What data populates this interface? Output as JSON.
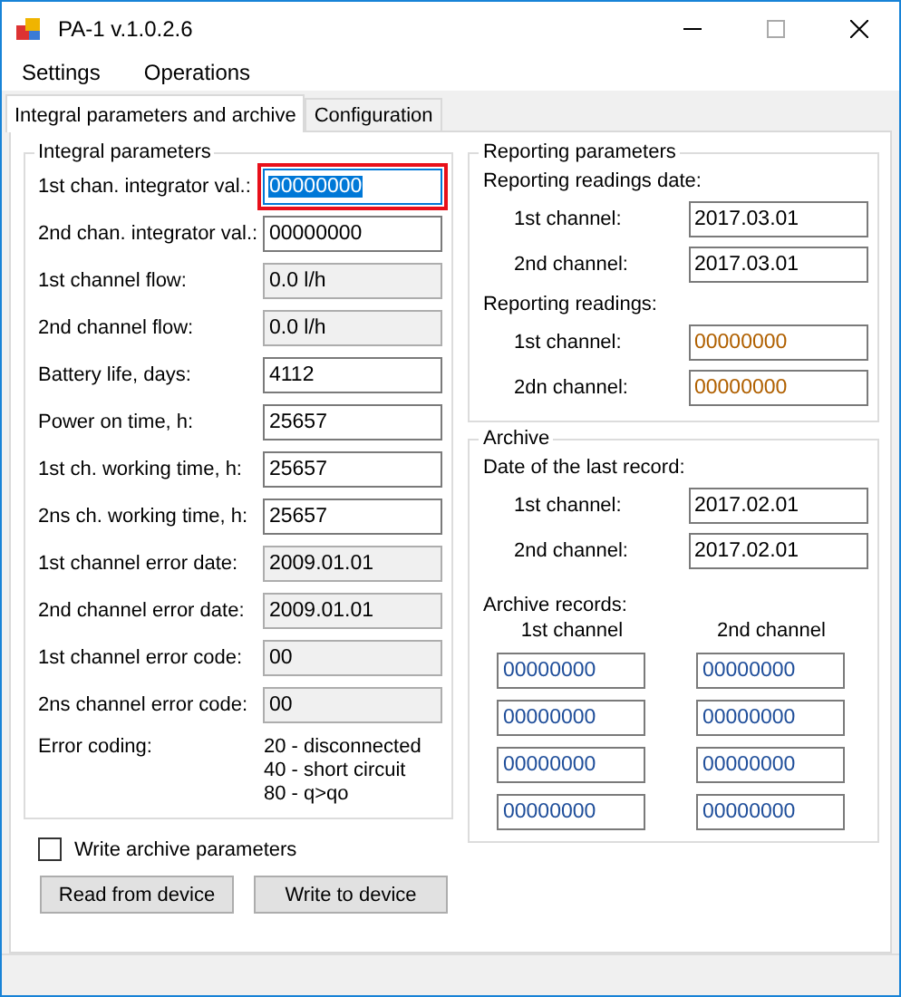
{
  "window": {
    "title": "PA-1 v.1.0.2.6"
  },
  "menu": [
    "Settings",
    "Operations"
  ],
  "tabs": [
    {
      "label": "Integral parameters and archive",
      "selected": true
    },
    {
      "label": "Configuration",
      "selected": false
    }
  ],
  "integral": {
    "title": "Integral parameters",
    "fields": [
      {
        "label": "1st chan. integrator val.:",
        "value": "00000000",
        "kind": "input",
        "focused": true
      },
      {
        "label": "2nd chan. integrator val.:",
        "value": "00000000",
        "kind": "input",
        "focused": false
      },
      {
        "label": "1st channel flow:",
        "value": "0.0 l/h",
        "kind": "readonly",
        "focused": false
      },
      {
        "label": "2nd channel flow:",
        "value": "0.0 l/h",
        "kind": "readonly",
        "focused": false
      },
      {
        "label": "Battery life, days:",
        "value": "4112",
        "kind": "input",
        "focused": false
      },
      {
        "label": "Power on time, h:",
        "value": "25657",
        "kind": "input",
        "focused": false
      },
      {
        "label": "1st ch. working time, h:",
        "value": "25657",
        "kind": "input",
        "focused": false
      },
      {
        "label": "2ns ch. working time, h:",
        "value": "25657",
        "kind": "input",
        "focused": false
      },
      {
        "label": "1st channel error date:",
        "value": "2009.01.01",
        "kind": "readonly",
        "focused": false
      },
      {
        "label": "2nd channel error date:",
        "value": "2009.01.01",
        "kind": "readonly",
        "focused": false
      },
      {
        "label": "1st channel error code:",
        "value": "00",
        "kind": "readonly",
        "focused": false
      },
      {
        "label": "2ns channel error code:",
        "value": "00",
        "kind": "readonly",
        "focused": false
      }
    ],
    "error_coding": {
      "label": "Error coding:",
      "lines": [
        "20 - disconnected",
        "40 - short circuit",
        "80 - q>qo"
      ]
    }
  },
  "write_archive": {
    "label": "Write archive parameters",
    "checked": false
  },
  "buttons": [
    "Read from device",
    "Write to device"
  ],
  "reporting": {
    "title": "Reporting parameters",
    "sections": [
      {
        "heading": "Reporting readings date:",
        "fields": [
          {
            "label": "1st channel:",
            "value": "2017.03.01",
            "kind": "input"
          },
          {
            "label": "2nd channel:",
            "value": "2017.03.01",
            "kind": "input"
          }
        ]
      },
      {
        "heading": "Reporting readings:",
        "fields": [
          {
            "label": "1st channel:",
            "value": "00000000",
            "kind": "counter"
          },
          {
            "label": "2dn channel:",
            "value": "00000000",
            "kind": "counter"
          }
        ]
      }
    ]
  },
  "archive": {
    "title": "Archive",
    "heading": "Date of the last record:",
    "fields": [
      {
        "label": "1st channel:",
        "value": "2017.02.01",
        "kind": "input"
      },
      {
        "label": "2nd channel:",
        "value": "2017.02.01",
        "kind": "input"
      }
    ],
    "records_heading": "Archive records:",
    "columns": [
      "1st channel",
      "2nd channel"
    ],
    "rows": [
      {
        "cells": [
          {
            "value": "00000000",
            "kind": "record"
          },
          {
            "value": "00000000",
            "kind": "record"
          }
        ]
      },
      {
        "cells": [
          {
            "value": "00000000",
            "kind": "record"
          },
          {
            "value": "00000000",
            "kind": "record"
          }
        ]
      },
      {
        "cells": [
          {
            "value": "00000000",
            "kind": "record"
          },
          {
            "value": "00000000",
            "kind": "record"
          }
        ]
      },
      {
        "cells": [
          {
            "value": "00000000",
            "kind": "record"
          },
          {
            "value": "00000000",
            "kind": "record"
          }
        ]
      }
    ]
  }
}
